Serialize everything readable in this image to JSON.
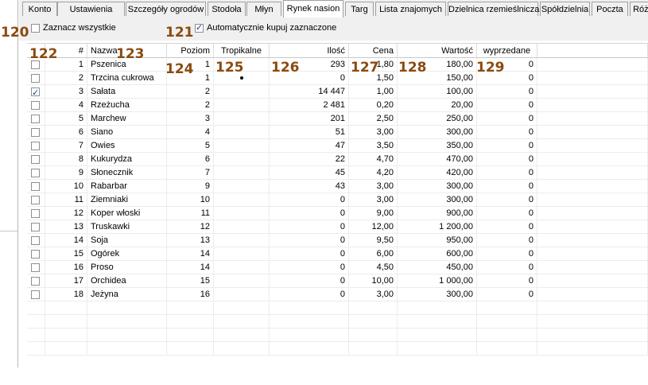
{
  "tabs": [
    {
      "label": "Konto"
    },
    {
      "label": "Ustawienia"
    },
    {
      "label": "Szczegóły ogrodów"
    },
    {
      "label": "Stodoła"
    },
    {
      "label": "Młyn"
    },
    {
      "label": "Rynek nasion",
      "active": true
    },
    {
      "label": "Targ"
    },
    {
      "label": "Lista znajomych"
    },
    {
      "label": "Dzielnica rzemieślnicza"
    },
    {
      "label": "Spółdzielnia"
    },
    {
      "label": "Poczta"
    },
    {
      "label": "Różne"
    }
  ],
  "options": {
    "select_all_label": "Zaznacz wszystkie",
    "select_all_checked": false,
    "auto_buy_label": "Automatycznie kupuj zaznaczone",
    "auto_buy_checked": true
  },
  "annotations": [
    "120",
    "121",
    "122",
    "123",
    "124",
    "125",
    "126",
    "127",
    "128",
    "129"
  ],
  "table": {
    "columns": [
      "",
      "#",
      "Nazwa",
      "Poziom",
      "Tropikalne",
      "Ilość",
      "Cena",
      "Wartość",
      "wyprzedane"
    ],
    "rows": [
      {
        "checked": false,
        "idx": "1",
        "name": "Pszenica",
        "level": "1",
        "tropical": false,
        "qty": "293",
        "price": "1,80",
        "value": "180,00",
        "sold": "0"
      },
      {
        "checked": false,
        "idx": "2",
        "name": "Trzcina cukrowa",
        "level": "1",
        "tropical": true,
        "qty": "0",
        "price": "1,50",
        "value": "150,00",
        "sold": "0"
      },
      {
        "checked": true,
        "idx": "3",
        "name": "Sałata",
        "level": "2",
        "tropical": false,
        "qty": "14 447",
        "price": "1,00",
        "value": "100,00",
        "sold": "0"
      },
      {
        "checked": false,
        "idx": "4",
        "name": "Rzeżucha",
        "level": "2",
        "tropical": false,
        "qty": "2 481",
        "price": "0,20",
        "value": "20,00",
        "sold": "0"
      },
      {
        "checked": false,
        "idx": "5",
        "name": "Marchew",
        "level": "3",
        "tropical": false,
        "qty": "201",
        "price": "2,50",
        "value": "250,00",
        "sold": "0"
      },
      {
        "checked": false,
        "idx": "6",
        "name": "Siano",
        "level": "4",
        "tropical": false,
        "qty": "51",
        "price": "3,00",
        "value": "300,00",
        "sold": "0"
      },
      {
        "checked": false,
        "idx": "7",
        "name": "Owies",
        "level": "5",
        "tropical": false,
        "qty": "47",
        "price": "3,50",
        "value": "350,00",
        "sold": "0"
      },
      {
        "checked": false,
        "idx": "8",
        "name": "Kukurydza",
        "level": "6",
        "tropical": false,
        "qty": "22",
        "price": "4,70",
        "value": "470,00",
        "sold": "0"
      },
      {
        "checked": false,
        "idx": "9",
        "name": "Słonecznik",
        "level": "7",
        "tropical": false,
        "qty": "45",
        "price": "4,20",
        "value": "420,00",
        "sold": "0"
      },
      {
        "checked": false,
        "idx": "10",
        "name": "Rabarbar",
        "level": "9",
        "tropical": false,
        "qty": "43",
        "price": "3,00",
        "value": "300,00",
        "sold": "0"
      },
      {
        "checked": false,
        "idx": "11",
        "name": "Ziemniaki",
        "level": "10",
        "tropical": false,
        "qty": "0",
        "price": "3,00",
        "value": "300,00",
        "sold": "0"
      },
      {
        "checked": false,
        "idx": "12",
        "name": "Koper włoski",
        "level": "11",
        "tropical": false,
        "qty": "0",
        "price": "9,00",
        "value": "900,00",
        "sold": "0"
      },
      {
        "checked": false,
        "idx": "13",
        "name": "Truskawki",
        "level": "12",
        "tropical": false,
        "qty": "0",
        "price": "12,00",
        "value": "1 200,00",
        "sold": "0"
      },
      {
        "checked": false,
        "idx": "14",
        "name": "Soja",
        "level": "13",
        "tropical": false,
        "qty": "0",
        "price": "9,50",
        "value": "950,00",
        "sold": "0"
      },
      {
        "checked": false,
        "idx": "15",
        "name": "Ogórek",
        "level": "14",
        "tropical": false,
        "qty": "0",
        "price": "6,00",
        "value": "600,00",
        "sold": "0"
      },
      {
        "checked": false,
        "idx": "16",
        "name": "Proso",
        "level": "14",
        "tropical": false,
        "qty": "0",
        "price": "4,50",
        "value": "450,00",
        "sold": "0"
      },
      {
        "checked": false,
        "idx": "17",
        "name": "Orchidea",
        "level": "15",
        "tropical": false,
        "qty": "0",
        "price": "10,00",
        "value": "1 000,00",
        "sold": "0"
      },
      {
        "checked": false,
        "idx": "18",
        "name": "Jeżyna",
        "level": "16",
        "tropical": false,
        "qty": "0",
        "price": "3,00",
        "value": "300,00",
        "sold": "0"
      }
    ]
  }
}
